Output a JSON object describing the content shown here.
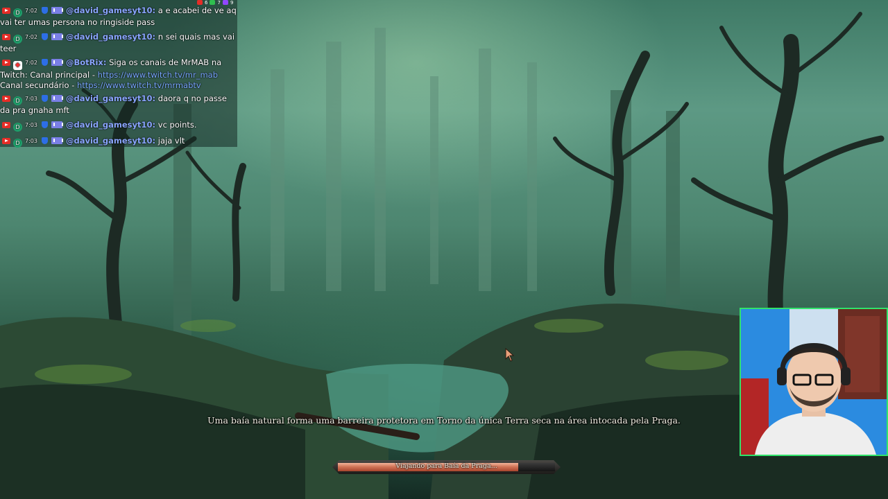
{
  "chat": {
    "messages": [
      {
        "platform": "youtube-icon",
        "avatar": "D",
        "time": "7:02",
        "user": "@david_gamesyt10:",
        "text": "a e acabei de ve aq vai ter umas persona no ringiside pass"
      },
      {
        "platform": "youtube-icon",
        "avatar": "D",
        "time": "7:02",
        "user": "@david_gamesyt10:",
        "text": "n sei quais mas vai teer"
      },
      {
        "platform": "youtube-icon",
        "avatar": "bot",
        "time": "7:02",
        "user": "@BotRix:",
        "text": "Siga os canais de MrMAB na Twitch: Canal principal - ",
        "link1": "https://www.twitch.tv/mr_mab",
        "text2": " Canal secundário - ",
        "link2": "https://www.twitch.tv/mrmabtv"
      },
      {
        "platform": "youtube-icon",
        "avatar": "D",
        "time": "7:03",
        "user": "@david_gamesyt10:",
        "text": "daora q no passe da pra gnaha mft"
      },
      {
        "platform": "youtube-icon",
        "avatar": "D",
        "time": "7:03",
        "user": "@david_gamesyt10:",
        "text": "vc points."
      },
      {
        "platform": "youtube-icon",
        "avatar": "D",
        "time": "7:03",
        "user": "@david_gamesyt10:",
        "text": "jaja vlt"
      }
    ],
    "top_badges": {
      "red_count": "6",
      "green_count": "7",
      "purple_count": "9"
    }
  },
  "game": {
    "caption": "Uma baía natural forma uma barreira protetora em Torno da única Terra seca na área intocada pela Praga.",
    "loading_label": "Viajando para Baía da Praga...",
    "loading_progress": 0.83
  },
  "colors": {
    "webcam_border": "#31e36b",
    "username": "#8aa6ff",
    "loading_fill": "#c9654a"
  }
}
